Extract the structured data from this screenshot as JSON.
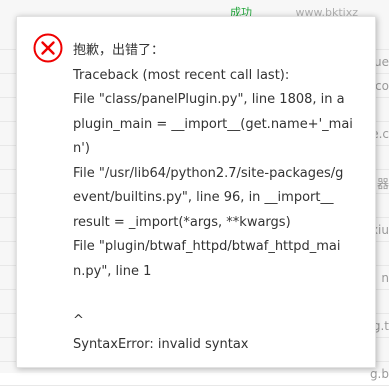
{
  "background": {
    "top_text_green": "成功",
    "top_text_gray": "www.bktixz",
    "right_fragments": [
      "",
      "ue",
      ".co",
      "",
      "e.c",
      "",
      "器",
      "",
      "xiu",
      "",
      "n",
      "",
      "g.t",
      "",
      "g.b"
    ]
  },
  "dialog": {
    "icon": "error-circle-x-icon",
    "icon_color": "#ef0000",
    "lines": [
      "抱歉，出错了：",
      "Traceback (most recent call last):",
      "File \"class/panelPlugin.py\", line 1808, in a",
      "plugin_main = __import__(get.name+'_mai",
      "n')",
      "File \"/usr/lib64/python2.7/site-packages/g",
      "event/builtins.py\", line 96, in __import__",
      "result = _import(*args, **kwargs)",
      "File \"plugin/btwaf_httpd/btwaf_httpd_mai",
      "n.py\", line 1",
      "",
      "^",
      "SyntaxError: invalid syntax"
    ]
  }
}
